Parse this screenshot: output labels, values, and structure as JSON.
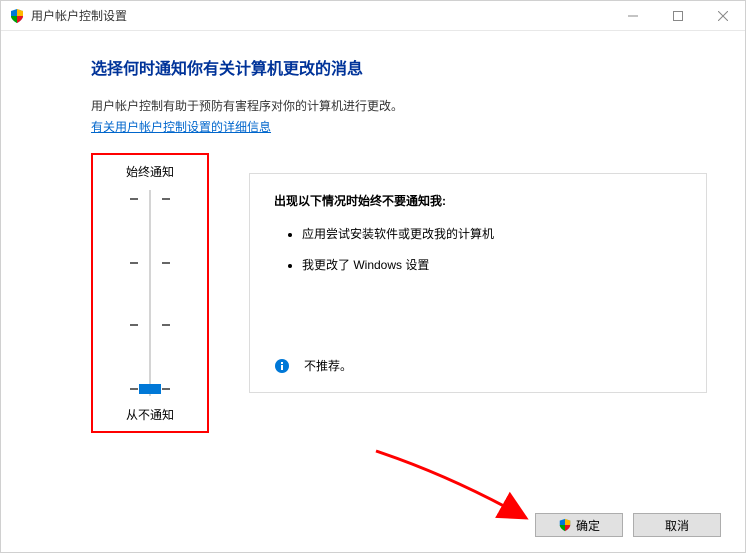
{
  "window": {
    "title": "用户帐户控制设置"
  },
  "header": {
    "title": "选择何时通知你有关计算机更改的消息",
    "description": "用户帐户控制有助于预防有害程序对你的计算机进行更改。",
    "link": "有关用户帐户控制设置的详细信息"
  },
  "slider": {
    "topLabel": "始终通知",
    "bottomLabel": "从不通知",
    "levels": 4,
    "currentLevel": 0
  },
  "detail": {
    "heading": "出现以下情况时始终不要通知我:",
    "bullets": [
      "应用尝试安装软件或更改我的计算机",
      "我更改了 Windows 设置"
    ],
    "recommendation": "不推荐。"
  },
  "buttons": {
    "ok": "确定",
    "cancel": "取消"
  }
}
